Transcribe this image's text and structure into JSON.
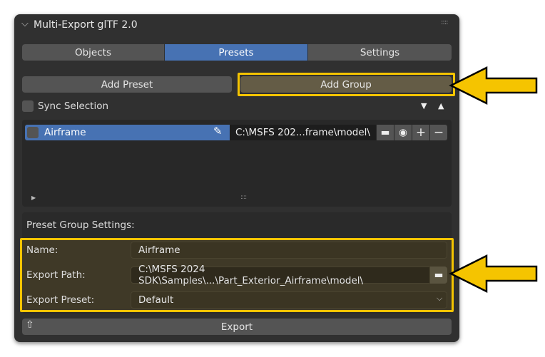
{
  "panel": {
    "title": "Multi-Export glTF 2.0"
  },
  "tabs": [
    {
      "label": "Objects"
    },
    {
      "label": "Presets",
      "active": true
    },
    {
      "label": "Settings"
    }
  ],
  "buttons": {
    "add_preset": "Add Preset",
    "add_group": "Add Group",
    "export": "Export"
  },
  "sync": {
    "label": "Sync Selection",
    "checked": false
  },
  "list": {
    "items": [
      {
        "name": "Airframe",
        "path": "C:\\MSFS 202...frame\\model\\",
        "checked": false,
        "selected": true
      }
    ]
  },
  "group_settings": {
    "header": "Preset Group Settings:",
    "name_label": "Name:",
    "name_value": "Airframe",
    "path_label": "Export Path:",
    "path_value": "C:\\MSFS 2024 SDK\\Samples\\...\\Part_Exterior_Airframe\\model\\",
    "preset_label": "Export Preset:",
    "preset_value": "Default"
  },
  "colors": {
    "accent": "#4772b3",
    "highlight": "#f5c400",
    "panel": "#303030"
  }
}
